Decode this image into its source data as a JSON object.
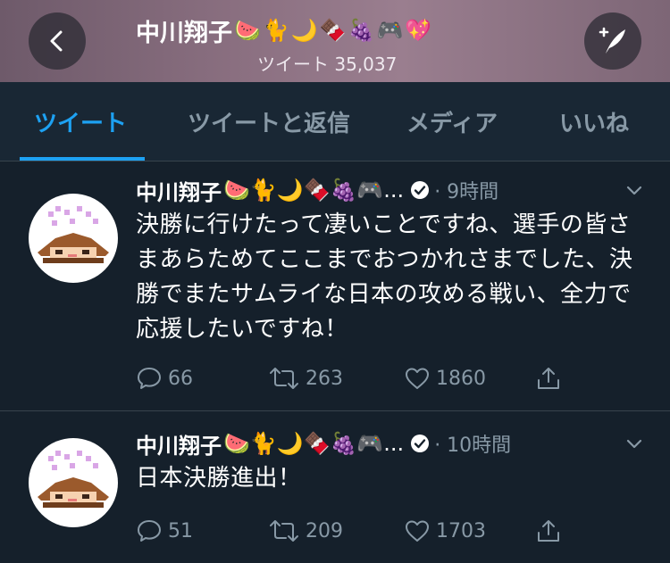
{
  "header": {
    "name": "中川翔子",
    "emojis": [
      "🍉",
      "🐈",
      "🌙",
      "🍫",
      "🍇",
      "🎮",
      "💖"
    ],
    "tweet_count_label": "ツイート 35,037"
  },
  "tabs": [
    {
      "label": "ツイート",
      "active": true
    },
    {
      "label": "ツイートと返信",
      "active": false
    },
    {
      "label": "メディア",
      "active": false
    },
    {
      "label": "いいね",
      "active": false
    }
  ],
  "tweets": [
    {
      "name": "中川翔子",
      "emojis": "🍉🐈🌙🍫🍇🎮...",
      "time": "· 9時間",
      "text": "決勝に行けたって凄いことですね、選手の皆さまあらためてここまでおつかれさまでした、決勝でまたサムライな日本の攻める戦い、全力で応援したいですね！",
      "replies": "66",
      "retweets": "263",
      "likes": "1860"
    },
    {
      "name": "中川翔子",
      "emojis": "🍉🐈🌙🍫🍇🎮...",
      "time": "· 10時間",
      "text": "日本決勝進出！",
      "replies": "51",
      "retweets": "209",
      "likes": "1703"
    }
  ],
  "colors": {
    "background": "#15202b",
    "accent": "#1da1f2",
    "muted": "#8899a6"
  }
}
